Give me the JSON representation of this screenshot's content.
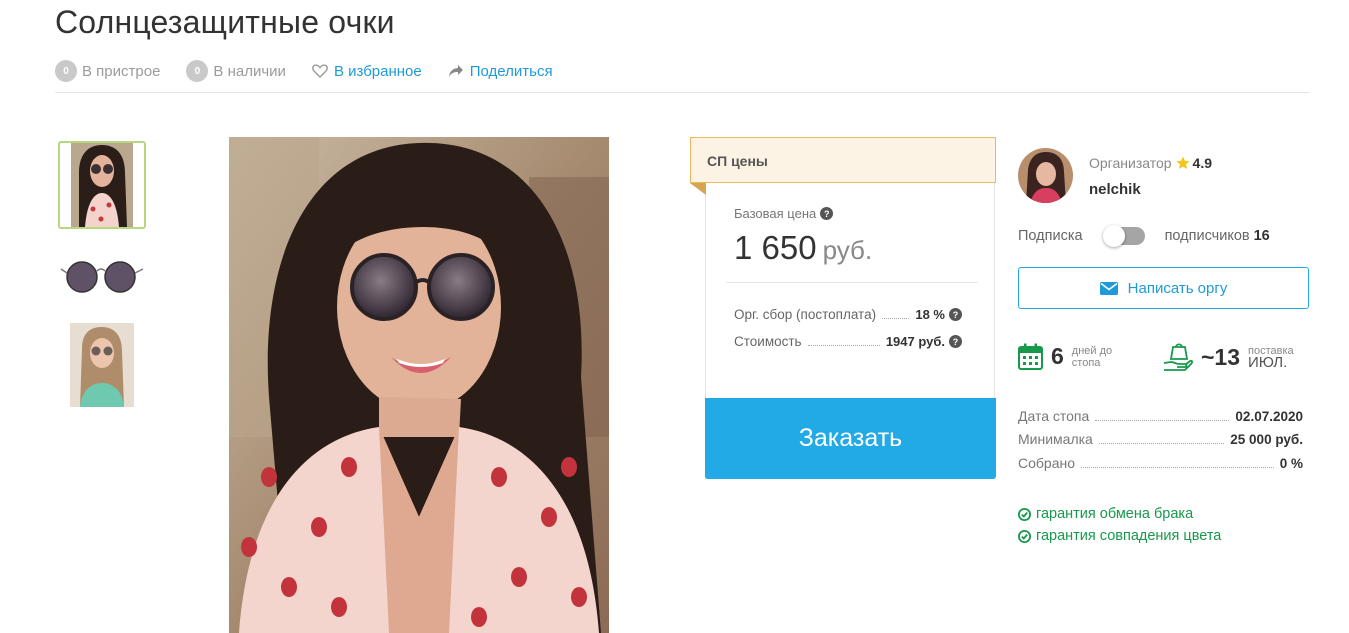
{
  "title": "Солнцезащитные очки",
  "meta": {
    "pristroy_count": "0",
    "pristroy_label": "В пристрое",
    "stock_count": "0",
    "stock_label": "В наличии",
    "favorite_label": "В избранное",
    "share_label": "Поделиться"
  },
  "thumbnails": [
    "photo-model-glasses",
    "photo-glasses-product",
    "photo-model-blonde"
  ],
  "price": {
    "header": "СП цены",
    "base_label": "Базовая цена",
    "base_value": "1 650",
    "currency": "руб.",
    "fee_label": "Орг. сбор (постоплата)",
    "fee_value": "18 %",
    "cost_label": "Стоимость",
    "cost_value": "1947 руб.",
    "order_button": "Заказать"
  },
  "organizer": {
    "label": "Организатор",
    "rating": "4.9",
    "name": "nelchik",
    "subscribe_label": "Подписка",
    "subscribers_label": "подписчиков",
    "subscribers_count": "16",
    "subscribed": false,
    "write_button": "Написать оргу"
  },
  "stats": {
    "days_value": "6",
    "days_line1": "дней до",
    "days_line2": "стопа",
    "delivery_value": "~13",
    "delivery_line1": "поставка",
    "delivery_line2": "ИЮЛ."
  },
  "info": [
    {
      "label": "Дата стопа",
      "value": "02.07.2020"
    },
    {
      "label": "Минималка",
      "value": "25 000 руб."
    },
    {
      "label": "Собрано",
      "value": "0 %"
    }
  ],
  "guarantees": [
    "гарантия обмена брака",
    "гарантия совпадения цвета"
  ],
  "colors": {
    "accent_blue": "#22aae6",
    "link_blue": "#1e9bd7",
    "green": "#17994b",
    "price_header_bg": "#fdf3e5",
    "price_header_border": "#e8b95e",
    "thumb_active_border": "#b7d77e",
    "star": "#f5c518"
  }
}
